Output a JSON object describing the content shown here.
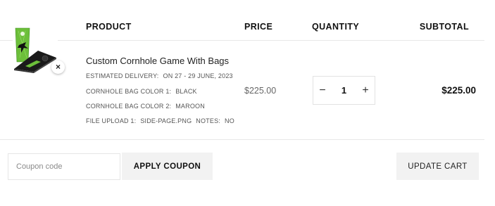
{
  "table_header": {
    "product": "PRODUCT",
    "price": "PRICE",
    "quantity": "QUANTITY",
    "subtotal": "SUBTOTAL"
  },
  "cart_item": {
    "remove_symbol": "×",
    "name": "Custom Cornhole Game With Bags",
    "meta": [
      {
        "key": "ESTIMATED DELIVERY:",
        "value": "ON 27 - 29 JUNE, 2023"
      },
      {
        "key": "CORNHOLE BAG COLOR 1:",
        "value": "BLACK"
      },
      {
        "key": "CORNHOLE BAG COLOR 2:",
        "value": "MAROON"
      },
      {
        "key": "FILE UPLOAD 1:",
        "value": "SIDE-PAGE.PNG",
        "key2": "NOTES:",
        "value2": "NO"
      }
    ],
    "price": "$225.00",
    "quantity": {
      "minus": "−",
      "value": "1",
      "plus": "+"
    },
    "subtotal": "$225.00"
  },
  "actions": {
    "coupon_placeholder": "Coupon code",
    "apply_coupon_label": "APPLY COUPON",
    "update_cart_label": "UPDATE CART"
  },
  "colors": {
    "board_green": "#6cbf3a",
    "board_black": "#1a1a1a",
    "button_bg": "#f2f2f2",
    "divider": "#e8e8e8"
  }
}
